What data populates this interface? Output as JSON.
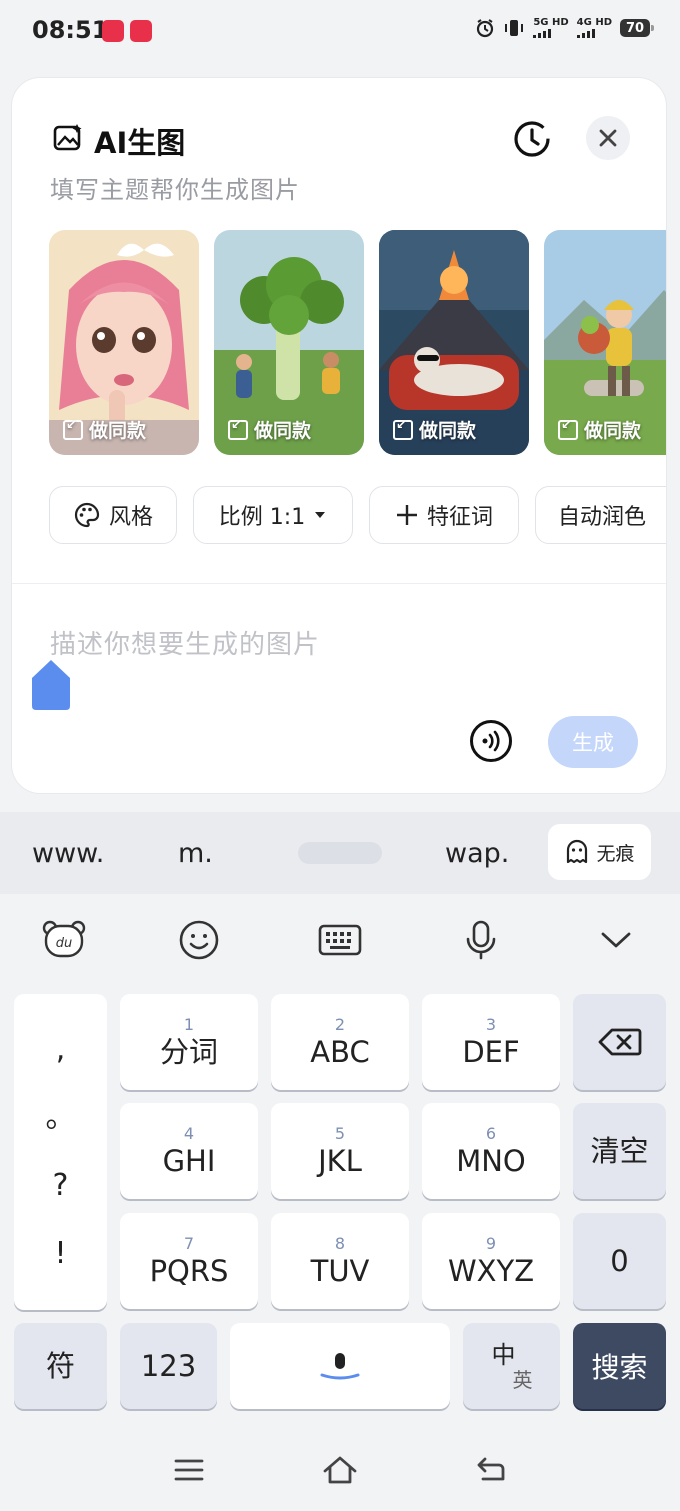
{
  "status_bar": {
    "time": "08:51",
    "app_badge_1": "",
    "app_badge_2": "",
    "net1_label": "5G HD",
    "net2_label": "4G HD",
    "battery": "70"
  },
  "card": {
    "title": "AI生图",
    "subtitle": "填写主题帮你生成图片",
    "samples": [
      {
        "tag": "做同款"
      },
      {
        "tag": "做同款"
      },
      {
        "tag": "做同款"
      },
      {
        "tag": "做同款"
      }
    ],
    "chips": {
      "style": "风格",
      "ratio": "比例 1:1",
      "keyword": "特征词",
      "polish": "自动润色"
    },
    "prompt_placeholder": "描述你想要生成的图片",
    "generate_label": "生成"
  },
  "suggestions": {
    "www": "www.",
    "m": "m.",
    "wap": "wap.",
    "incognito": "无痕"
  },
  "keyboard": {
    "punct": [
      ",",
      "。",
      "?",
      "!"
    ],
    "keys": [
      {
        "num": "1",
        "label": "分词"
      },
      {
        "num": "2",
        "label": "ABC"
      },
      {
        "num": "3",
        "label": "DEF"
      },
      {
        "num": "4",
        "label": "GHI"
      },
      {
        "num": "5",
        "label": "JKL"
      },
      {
        "num": "6",
        "label": "MNO"
      },
      {
        "num": "7",
        "label": "PQRS"
      },
      {
        "num": "8",
        "label": "TUV"
      },
      {
        "num": "9",
        "label": "WXYZ"
      }
    ],
    "clear": "清空",
    "zero": "0",
    "symbol": "符",
    "num_mode": "123",
    "lang_main": "中",
    "lang_sub": "英",
    "search": "搜索"
  },
  "colors": {
    "accent": "#5b8def",
    "generate_disabled": "#c5d6fb",
    "search_key": "#3d4a62"
  }
}
